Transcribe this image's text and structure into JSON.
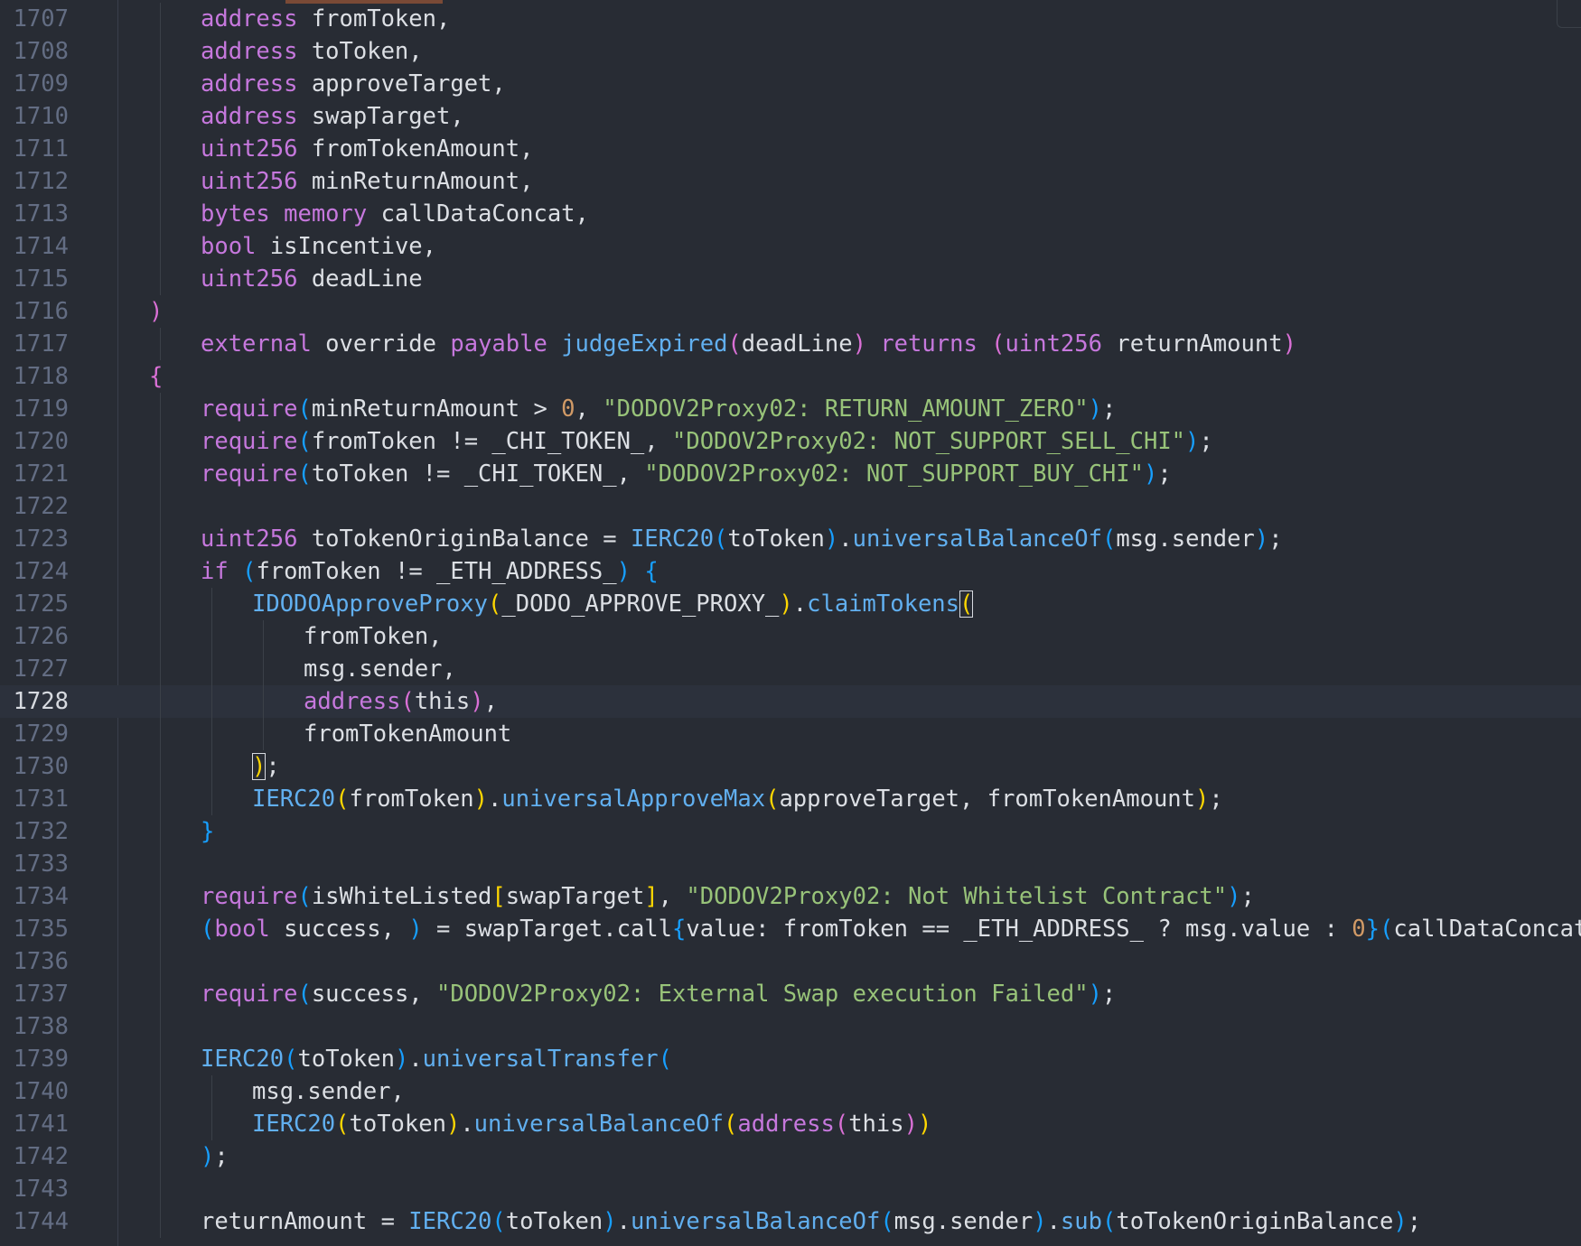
{
  "editor": {
    "current_line": 1728,
    "lines": [
      {
        "n": "1707",
        "indent": 2,
        "tokens": [
          {
            "t": "address",
            "c": "kw"
          },
          {
            "t": " fromToken,"
          }
        ]
      },
      {
        "n": "1708",
        "indent": 2,
        "tokens": [
          {
            "t": "address",
            "c": "kw"
          },
          {
            "t": " toToken,"
          }
        ]
      },
      {
        "n": "1709",
        "indent": 2,
        "tokens": [
          {
            "t": "address",
            "c": "kw"
          },
          {
            "t": " approveTarget,"
          }
        ]
      },
      {
        "n": "1710",
        "indent": 2,
        "tokens": [
          {
            "t": "address",
            "c": "kw"
          },
          {
            "t": " swapTarget,"
          }
        ]
      },
      {
        "n": "1711",
        "indent": 2,
        "tokens": [
          {
            "t": "uint256",
            "c": "kw"
          },
          {
            "t": " fromTokenAmount,"
          }
        ]
      },
      {
        "n": "1712",
        "indent": 2,
        "tokens": [
          {
            "t": "uint256",
            "c": "kw"
          },
          {
            "t": " minReturnAmount,"
          }
        ]
      },
      {
        "n": "1713",
        "indent": 2,
        "tokens": [
          {
            "t": "bytes",
            "c": "kw"
          },
          {
            "t": " "
          },
          {
            "t": "memory",
            "c": "kw"
          },
          {
            "t": " callDataConcat,"
          }
        ]
      },
      {
        "n": "1714",
        "indent": 2,
        "tokens": [
          {
            "t": "bool",
            "c": "kw"
          },
          {
            "t": " isIncentive,"
          }
        ]
      },
      {
        "n": "1715",
        "indent": 2,
        "tokens": [
          {
            "t": "uint256",
            "c": "kw"
          },
          {
            "t": " deadLine"
          }
        ]
      },
      {
        "n": "1716",
        "indent": 1,
        "tokens": [
          {
            "t": ")",
            "c": "p1"
          }
        ]
      },
      {
        "n": "1717",
        "indent": 2,
        "tokens": [
          {
            "t": "external",
            "c": "kw"
          },
          {
            "t": " override "
          },
          {
            "t": "payable",
            "c": "kw"
          },
          {
            "t": " "
          },
          {
            "t": "judgeExpired",
            "c": "fn"
          },
          {
            "t": "(",
            "c": "p1"
          },
          {
            "t": "deadLine"
          },
          {
            "t": ")",
            "c": "p1"
          },
          {
            "t": " "
          },
          {
            "t": "returns",
            "c": "kw"
          },
          {
            "t": " "
          },
          {
            "t": "(",
            "c": "p1"
          },
          {
            "t": "uint256",
            "c": "kw"
          },
          {
            "t": " returnAmount"
          },
          {
            "t": ")",
            "c": "p1"
          }
        ]
      },
      {
        "n": "1718",
        "indent": 1,
        "tokens": [
          {
            "t": "{",
            "c": "p1"
          }
        ]
      },
      {
        "n": "1719",
        "indent": 2,
        "tokens": [
          {
            "t": "require",
            "c": "kw"
          },
          {
            "t": "(",
            "c": "p3"
          },
          {
            "t": "minReturnAmount > "
          },
          {
            "t": "0",
            "c": "num"
          },
          {
            "t": ", "
          },
          {
            "t": "\"DODOV2Proxy02: RETURN_AMOUNT_ZERO\"",
            "c": "str"
          },
          {
            "t": ")",
            "c": "p3"
          },
          {
            "t": ";"
          }
        ]
      },
      {
        "n": "1720",
        "indent": 2,
        "tokens": [
          {
            "t": "require",
            "c": "kw"
          },
          {
            "t": "(",
            "c": "p3"
          },
          {
            "t": "fromToken != _CHI_TOKEN_, "
          },
          {
            "t": "\"DODOV2Proxy02: NOT_SUPPORT_SELL_CHI\"",
            "c": "str"
          },
          {
            "t": ")",
            "c": "p3"
          },
          {
            "t": ";"
          }
        ]
      },
      {
        "n": "1721",
        "indent": 2,
        "tokens": [
          {
            "t": "require",
            "c": "kw"
          },
          {
            "t": "(",
            "c": "p3"
          },
          {
            "t": "toToken != _CHI_TOKEN_, "
          },
          {
            "t": "\"DODOV2Proxy02: NOT_SUPPORT_BUY_CHI\"",
            "c": "str"
          },
          {
            "t": ")",
            "c": "p3"
          },
          {
            "t": ";"
          }
        ]
      },
      {
        "n": "1722",
        "indent": 2,
        "tokens": []
      },
      {
        "n": "1723",
        "indent": 2,
        "tokens": [
          {
            "t": "uint256",
            "c": "kw"
          },
          {
            "t": " toTokenOriginBalance = "
          },
          {
            "t": "IERC20",
            "c": "fn"
          },
          {
            "t": "(",
            "c": "p3"
          },
          {
            "t": "toToken"
          },
          {
            "t": ")",
            "c": "p3"
          },
          {
            "t": "."
          },
          {
            "t": "universalBalanceOf",
            "c": "fn"
          },
          {
            "t": "(",
            "c": "p3"
          },
          {
            "t": "msg.sender"
          },
          {
            "t": ")",
            "c": "p3"
          },
          {
            "t": ";"
          }
        ]
      },
      {
        "n": "1724",
        "indent": 2,
        "tokens": [
          {
            "t": "if",
            "c": "kw"
          },
          {
            "t": " "
          },
          {
            "t": "(",
            "c": "p3"
          },
          {
            "t": "fromToken != _ETH_ADDRESS_"
          },
          {
            "t": ")",
            "c": "p3"
          },
          {
            "t": " "
          },
          {
            "t": "{",
            "c": "p3"
          }
        ]
      },
      {
        "n": "1725",
        "indent": 3,
        "tokens": [
          {
            "t": "IDODOApproveProxy",
            "c": "fn"
          },
          {
            "t": "(",
            "c": "p2"
          },
          {
            "t": "_DODO_APPROVE_PROXY_"
          },
          {
            "t": ")",
            "c": "p2"
          },
          {
            "t": "."
          },
          {
            "t": "claimTokens",
            "c": "fn"
          },
          {
            "t": "(",
            "c": "br"
          }
        ]
      },
      {
        "n": "1726",
        "indent": 4,
        "tokens": [
          {
            "t": "fromToken,"
          }
        ]
      },
      {
        "n": "1727",
        "indent": 4,
        "tokens": [
          {
            "t": "msg.sender,"
          }
        ]
      },
      {
        "n": "1728",
        "indent": 4,
        "tokens": [
          {
            "t": "address",
            "c": "kw"
          },
          {
            "t": "(",
            "c": "p1"
          },
          {
            "t": "this"
          },
          {
            "t": ")",
            "c": "p1"
          },
          {
            "t": ","
          }
        ]
      },
      {
        "n": "1729",
        "indent": 4,
        "tokens": [
          {
            "t": "fromTokenAmount"
          }
        ]
      },
      {
        "n": "1730",
        "indent": 3,
        "tokens": [
          {
            "t": ")",
            "c": "br"
          },
          {
            "t": ";"
          }
        ]
      },
      {
        "n": "1731",
        "indent": 3,
        "tokens": [
          {
            "t": "IERC20",
            "c": "fn"
          },
          {
            "t": "(",
            "c": "p2"
          },
          {
            "t": "fromToken"
          },
          {
            "t": ")",
            "c": "p2"
          },
          {
            "t": "."
          },
          {
            "t": "universalApproveMax",
            "c": "fn"
          },
          {
            "t": "(",
            "c": "p2"
          },
          {
            "t": "approveTarget, fromTokenAmount"
          },
          {
            "t": ")",
            "c": "p2"
          },
          {
            "t": ";"
          }
        ]
      },
      {
        "n": "1732",
        "indent": 2,
        "tokens": [
          {
            "t": "}",
            "c": "p3"
          }
        ]
      },
      {
        "n": "1733",
        "indent": 2,
        "tokens": []
      },
      {
        "n": "1734",
        "indent": 2,
        "tokens": [
          {
            "t": "require",
            "c": "kw"
          },
          {
            "t": "(",
            "c": "p3"
          },
          {
            "t": "isWhiteListed"
          },
          {
            "t": "[",
            "c": "p2"
          },
          {
            "t": "swapTarget"
          },
          {
            "t": "]",
            "c": "p2"
          },
          {
            "t": ", "
          },
          {
            "t": "\"DODOV2Proxy02: Not Whitelist Contract\"",
            "c": "str"
          },
          {
            "t": ")",
            "c": "p3"
          },
          {
            "t": ";"
          }
        ]
      },
      {
        "n": "1735",
        "indent": 2,
        "tokens": [
          {
            "t": "(",
            "c": "p3"
          },
          {
            "t": "bool",
            "c": "kw"
          },
          {
            "t": " success, "
          },
          {
            "t": ")",
            "c": "p3"
          },
          {
            "t": " = swapTarget.call"
          },
          {
            "t": "{",
            "c": "p3"
          },
          {
            "t": "value: fromToken == _ETH_ADDRESS_ ? msg.value : "
          },
          {
            "t": "0",
            "c": "num"
          },
          {
            "t": "}",
            "c": "p3"
          },
          {
            "t": "(",
            "c": "p3"
          },
          {
            "t": "callDataConcat"
          },
          {
            "t": ")",
            "c": "p3"
          },
          {
            "t": ";"
          }
        ]
      },
      {
        "n": "1736",
        "indent": 2,
        "tokens": []
      },
      {
        "n": "1737",
        "indent": 2,
        "tokens": [
          {
            "t": "require",
            "c": "kw"
          },
          {
            "t": "(",
            "c": "p3"
          },
          {
            "t": "success, "
          },
          {
            "t": "\"DODOV2Proxy02: External Swap execution Failed\"",
            "c": "str"
          },
          {
            "t": ")",
            "c": "p3"
          },
          {
            "t": ";"
          }
        ]
      },
      {
        "n": "1738",
        "indent": 2,
        "tokens": []
      },
      {
        "n": "1739",
        "indent": 2,
        "tokens": [
          {
            "t": "IERC20",
            "c": "fn"
          },
          {
            "t": "(",
            "c": "p3"
          },
          {
            "t": "toToken"
          },
          {
            "t": ")",
            "c": "p3"
          },
          {
            "t": "."
          },
          {
            "t": "universalTransfer",
            "c": "fn"
          },
          {
            "t": "(",
            "c": "p3"
          }
        ]
      },
      {
        "n": "1740",
        "indent": 3,
        "tokens": [
          {
            "t": "msg.sender,"
          }
        ]
      },
      {
        "n": "1741",
        "indent": 3,
        "tokens": [
          {
            "t": "IERC20",
            "c": "fn"
          },
          {
            "t": "(",
            "c": "p2"
          },
          {
            "t": "toToken"
          },
          {
            "t": ")",
            "c": "p2"
          },
          {
            "t": "."
          },
          {
            "t": "universalBalanceOf",
            "c": "fn"
          },
          {
            "t": "(",
            "c": "p2"
          },
          {
            "t": "address",
            "c": "kw"
          },
          {
            "t": "(",
            "c": "p1"
          },
          {
            "t": "this"
          },
          {
            "t": ")",
            "c": "p1"
          },
          {
            "t": ")",
            "c": "p2"
          }
        ]
      },
      {
        "n": "1742",
        "indent": 2,
        "tokens": [
          {
            "t": ")",
            "c": "p3"
          },
          {
            "t": ";"
          }
        ]
      },
      {
        "n": "1743",
        "indent": 2,
        "tokens": []
      },
      {
        "n": "1744",
        "indent": 2,
        "tokens": [
          {
            "t": "returnAmount = "
          },
          {
            "t": "IERC20",
            "c": "fn"
          },
          {
            "t": "(",
            "c": "p3"
          },
          {
            "t": "toToken"
          },
          {
            "t": ")",
            "c": "p3"
          },
          {
            "t": "."
          },
          {
            "t": "universalBalanceOf",
            "c": "fn"
          },
          {
            "t": "(",
            "c": "p3"
          },
          {
            "t": "msg.sender"
          },
          {
            "t": ")",
            "c": "p3"
          },
          {
            "t": "."
          },
          {
            "t": "sub",
            "c": "fn"
          },
          {
            "t": "(",
            "c": "p3"
          },
          {
            "t": "toTokenOriginBalance"
          },
          {
            "t": ")",
            "c": "p3"
          },
          {
            "t": ";"
          }
        ]
      }
    ]
  },
  "colors": {
    "background": "#282c34",
    "current_line": "#2c313c",
    "line_number": "#636d83",
    "keyword": "#c678dd",
    "function": "#61afef",
    "string": "#98c379",
    "number": "#d19a66"
  }
}
